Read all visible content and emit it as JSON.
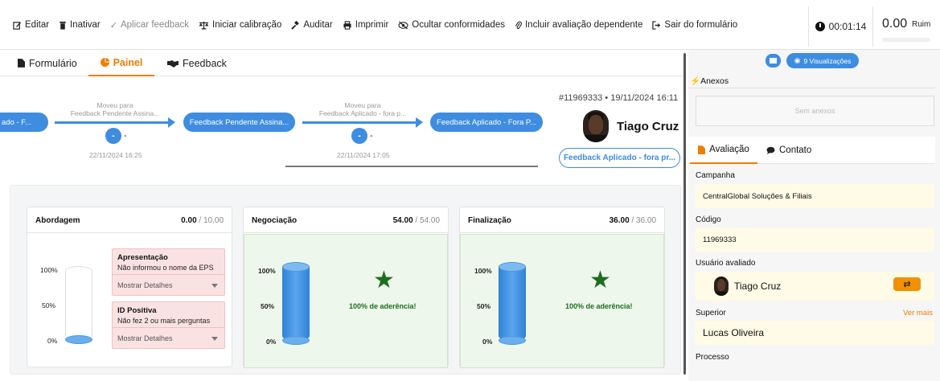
{
  "toolbar": {
    "items": [
      {
        "label": "Editar",
        "icon": "edit-icon",
        "disabled": false
      },
      {
        "label": "Inativar",
        "icon": "trash-icon",
        "disabled": false
      },
      {
        "label": "Aplicar feedback",
        "icon": "check-icon",
        "disabled": true
      },
      {
        "label": "Iniciar calibração",
        "icon": "scale-icon",
        "disabled": false
      },
      {
        "label": "Auditar",
        "icon": "gavel-icon",
        "disabled": false
      },
      {
        "label": "Imprimir",
        "icon": "printer-icon",
        "disabled": false
      },
      {
        "label": "Ocultar conformidades",
        "icon": "eye-slash-icon",
        "disabled": false
      },
      {
        "label": "Incluir avaliação dependente",
        "icon": "paperclip-icon",
        "disabled": false
      },
      {
        "label": "Sair do formulário",
        "icon": "sign-out-icon",
        "disabled": false
      }
    ],
    "timer": "00:01:14",
    "score": "0.00",
    "score_label": "Ruim"
  },
  "tabs": [
    {
      "label": "Formulário",
      "icon": "file-icon"
    },
    {
      "label": "Painel",
      "icon": "pie-chart-icon"
    },
    {
      "label": "Feedback",
      "icon": "handshake-icon"
    }
  ],
  "timeline": {
    "pill1": "ado - F...",
    "move1_line1": "Moveu para",
    "move1_line2": "Feedback Pendente Assina...",
    "pill2": "Feedback Pendente Assina...",
    "move2_line1": "Moveu para",
    "move2_line2": "Feedback Aplicado - fora p...",
    "pill3": "Feedback Aplicado - Fora P...",
    "dot1_label": "-",
    "dot1_dash": "-",
    "date1": "22/11/2024 16:25",
    "dot2_label": "-",
    "dot2_dash": "-",
    "date2": "22/11/2024 17:05"
  },
  "header": {
    "doc_id": "#11969333 • 19/11/2024 16:11",
    "user_name": "Tiago Cruz",
    "status": "Feedback Aplicado - fora pr..."
  },
  "cards": [
    {
      "title": "Abordagem",
      "score": "0.00",
      "max": " / 10.00",
      "pct_labels": [
        "100%",
        "50%",
        "0%"
      ],
      "fill_fraction": 0.0,
      "issues": [
        {
          "title": "Apresentação",
          "desc": "Não informou o nome da EPS",
          "details": "Mostrar Detalhes"
        },
        {
          "title": "ID Positiva",
          "desc": "Não fez 2 ou mais perguntas",
          "details": "Mostrar Detalhes"
        }
      ]
    },
    {
      "title": "Negociação",
      "score": "54.00",
      "max": " / 54.00",
      "pct_labels": [
        "100%",
        "50%",
        "0%"
      ],
      "fill_fraction": 1.0,
      "adherence": "100% de aderência!"
    },
    {
      "title": "Finalização",
      "score": "36.00",
      "max": " / 36.00",
      "pct_labels": [
        "100%",
        "50%",
        "0%"
      ],
      "fill_fraction": 1.0,
      "adherence": "100% de aderência!"
    }
  ],
  "right_panel": {
    "views": "9 Visualizações",
    "anexos_title": "Anexos",
    "sem_anexos": "Sem anexos",
    "tabs": [
      {
        "label": "Avaliação",
        "icon": "file-icon"
      },
      {
        "label": "Contato",
        "icon": "chat-icon"
      }
    ],
    "fields": {
      "campanha_label": "Campanha",
      "campanha_value": "CentralGlobal Soluções & Filiais",
      "codigo_label": "Código",
      "codigo_value": "11969333",
      "usuario_label": "Usuário avaliado",
      "usuario_value": "Tiago Cruz",
      "superior_label": "Superior",
      "superior_value": "Lucas Oliveira",
      "ver_mais": "Ver mais",
      "processo_label": "Processo"
    }
  },
  "colors": {
    "accent": "#f07d00",
    "primary": "#3e8de1",
    "success": "#1e6d1e"
  }
}
